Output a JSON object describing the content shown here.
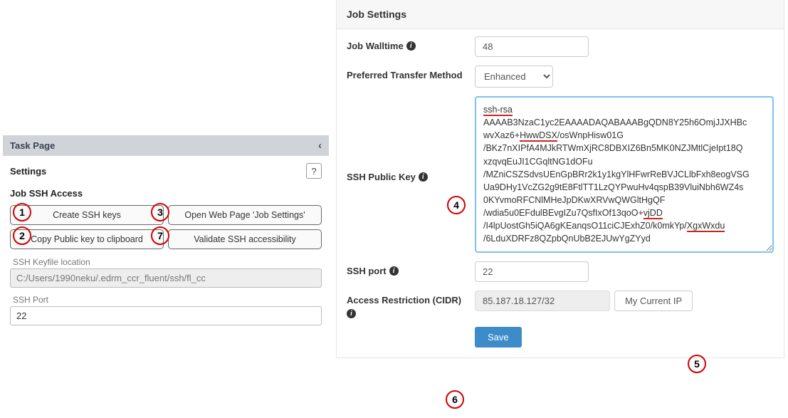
{
  "left": {
    "header": "Task Page",
    "settings_title": "Settings",
    "section": "Job SSH Access",
    "buttons": {
      "create_keys": "Create SSH keys",
      "open_web": "Open Web Page 'Job Settings'",
      "copy_clip": "Copy Public key to clipboard",
      "validate": "Validate SSH accessibility"
    },
    "keyfile_label": "SSH Keyfile location",
    "keyfile_value": "C:/Users/1990neku/.edrm_ccr_fluent/ssh/fl_cc",
    "port_label": "SSH Port",
    "port_value": "22"
  },
  "right": {
    "header": "Job Settings",
    "walltime_label": "Job Walltime",
    "walltime_value": "48",
    "transfer_label": "Preferred Transfer Method",
    "transfer_value": "Enhanced",
    "pubkey_label": "SSH Public Key",
    "pubkey_text_plain": "ssh-rsa AAAAB3NzaC1yc2EAAAADAQABAAABgQDN8Y25h6OmjJJXHBcwvXaz6+HwwDSX/osWnpHisw01G/BKz7nXIPfA4MJkRTWmXjRC8DBXIZ6Bn5MK0NZJMtlCjeIpt18QxzqvqEuJI1CGqltNG1dOFu/MZniCSZSdvsUEnGpBRr2k1y1kgYlHFwrReBVJCLlbFxh8eogVSGUa9DHy1VcZG2g9tE8FtlTT1LzQYPwuHv4qspB39VluiNbh6WZ4s0KYvmoRFCNlMHeJpDKwXRVwQWGltHgQF/wdia5u0EFdulBEvgIZu7QsfIxOf13qoO+vjDD/I4lpUostGh5iQA6gKEanqsO11ciCJExhZ0/k0mkYp/XgxWxdu/6LduXDRFz8QZpbQnUbB2EJUwYgZYyd",
    "sshport_label": "SSH port",
    "sshport_value": "22",
    "cidr_label": "Access Restriction (CIDR)",
    "cidr_value": "85.187.18.127/32",
    "cidr_btn": "My Current IP",
    "save": "Save"
  },
  "annotations": [
    "1",
    "2",
    "3",
    "4",
    "5",
    "6",
    "7"
  ]
}
